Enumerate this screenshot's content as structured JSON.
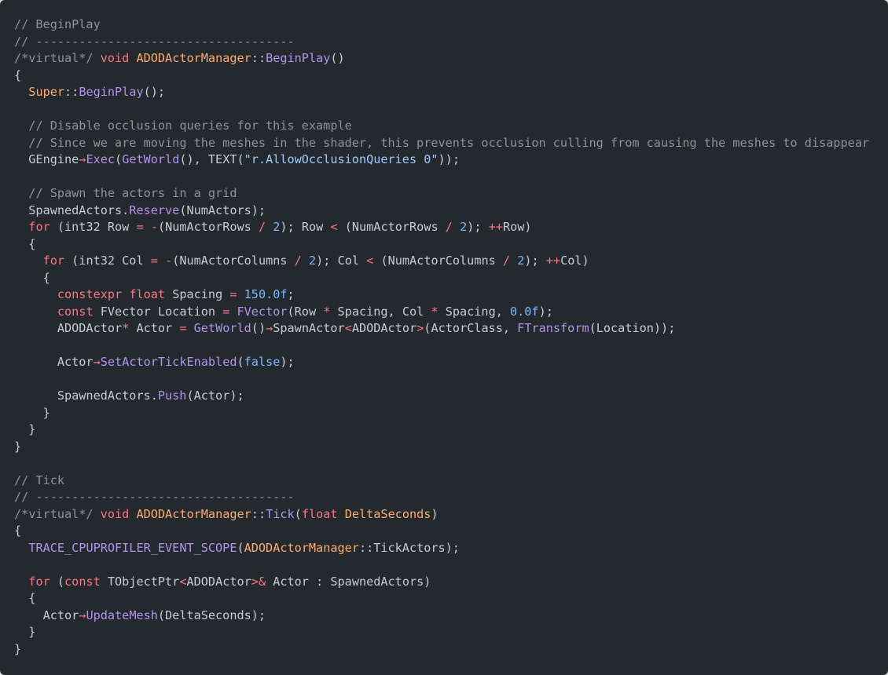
{
  "theme": {
    "background": "#24292e",
    "comment": "#8b949e",
    "keyword": "#f97583",
    "type": "#ffab70",
    "function": "#b392f0",
    "string": "#9ecbff",
    "number": "#79b8ff",
    "text": "#c6ccd4"
  },
  "code": {
    "lines": [
      [
        [
          "comment",
          "// BeginPlay"
        ]
      ],
      [
        [
          "comment",
          "// ------------------------------------"
        ]
      ],
      [
        [
          "comment",
          "/*virtual*/"
        ],
        [
          "plain",
          " "
        ],
        [
          "keyword",
          "void"
        ],
        [
          "plain",
          " "
        ],
        [
          "type",
          "ADODActorManager"
        ],
        [
          "plain",
          "::"
        ],
        [
          "func",
          "BeginPlay"
        ],
        [
          "plain",
          "()"
        ]
      ],
      [
        [
          "plain",
          "{"
        ]
      ],
      [
        [
          "plain",
          "  "
        ],
        [
          "type",
          "Super"
        ],
        [
          "plain",
          "::"
        ],
        [
          "func",
          "BeginPlay"
        ],
        [
          "plain",
          "();"
        ]
      ],
      [],
      [
        [
          "plain",
          "  "
        ],
        [
          "comment",
          "// Disable occlusion queries for this example"
        ]
      ],
      [
        [
          "plain",
          "  "
        ],
        [
          "comment",
          "// Since we are moving the meshes in the shader, this prevents occlusion culling from causing the meshes to disappear"
        ]
      ],
      [
        [
          "plain",
          "  GEngine"
        ],
        [
          "op",
          "→"
        ],
        [
          "func",
          "Exec"
        ],
        [
          "plain",
          "("
        ],
        [
          "func",
          "GetWorld"
        ],
        [
          "plain",
          "(), TEXT("
        ],
        [
          "string",
          "\"r.AllowOcclusionQueries 0\""
        ],
        [
          "plain",
          "));"
        ]
      ],
      [],
      [
        [
          "plain",
          "  "
        ],
        [
          "comment",
          "// Spawn the actors in a grid"
        ]
      ],
      [
        [
          "plain",
          "  SpawnedActors."
        ],
        [
          "func",
          "Reserve"
        ],
        [
          "plain",
          "(NumActors);"
        ]
      ],
      [
        [
          "plain",
          "  "
        ],
        [
          "keyword",
          "for"
        ],
        [
          "plain",
          " (int32 Row "
        ],
        [
          "op",
          "="
        ],
        [
          "plain",
          " "
        ],
        [
          "op",
          "-"
        ],
        [
          "plain",
          "(NumActorRows "
        ],
        [
          "op",
          "/"
        ],
        [
          "plain",
          " "
        ],
        [
          "number",
          "2"
        ],
        [
          "plain",
          "); Row "
        ],
        [
          "op",
          "<"
        ],
        [
          "plain",
          " (NumActorRows "
        ],
        [
          "op",
          "/"
        ],
        [
          "plain",
          " "
        ],
        [
          "number",
          "2"
        ],
        [
          "plain",
          "); "
        ],
        [
          "op",
          "++"
        ],
        [
          "plain",
          "Row)"
        ]
      ],
      [
        [
          "plain",
          "  {"
        ]
      ],
      [
        [
          "plain",
          "    "
        ],
        [
          "keyword",
          "for"
        ],
        [
          "plain",
          " (int32 Col "
        ],
        [
          "op",
          "="
        ],
        [
          "plain",
          " "
        ],
        [
          "op",
          "-"
        ],
        [
          "plain",
          "(NumActorColumns "
        ],
        [
          "op",
          "/"
        ],
        [
          "plain",
          " "
        ],
        [
          "number",
          "2"
        ],
        [
          "plain",
          "); Col "
        ],
        [
          "op",
          "<"
        ],
        [
          "plain",
          " (NumActorColumns "
        ],
        [
          "op",
          "/"
        ],
        [
          "plain",
          " "
        ],
        [
          "number",
          "2"
        ],
        [
          "plain",
          "); "
        ],
        [
          "op",
          "++"
        ],
        [
          "plain",
          "Col)"
        ]
      ],
      [
        [
          "plain",
          "    {"
        ]
      ],
      [
        [
          "plain",
          "      "
        ],
        [
          "keyword",
          "constexpr"
        ],
        [
          "plain",
          " "
        ],
        [
          "keyword",
          "float"
        ],
        [
          "plain",
          " Spacing "
        ],
        [
          "op",
          "="
        ],
        [
          "plain",
          " "
        ],
        [
          "number",
          "150.0f"
        ],
        [
          "plain",
          ";"
        ]
      ],
      [
        [
          "plain",
          "      "
        ],
        [
          "keyword",
          "const"
        ],
        [
          "plain",
          " FVector Location "
        ],
        [
          "op",
          "="
        ],
        [
          "plain",
          " "
        ],
        [
          "func",
          "FVector"
        ],
        [
          "plain",
          "(Row "
        ],
        [
          "op",
          "*"
        ],
        [
          "plain",
          " Spacing, Col "
        ],
        [
          "op",
          "*"
        ],
        [
          "plain",
          " Spacing, "
        ],
        [
          "number",
          "0.0f"
        ],
        [
          "plain",
          ");"
        ]
      ],
      [
        [
          "plain",
          "      ADODActor"
        ],
        [
          "op",
          "*"
        ],
        [
          "plain",
          " Actor "
        ],
        [
          "op",
          "="
        ],
        [
          "plain",
          " "
        ],
        [
          "func",
          "GetWorld"
        ],
        [
          "plain",
          "()"
        ],
        [
          "op",
          "→"
        ],
        [
          "plain",
          "SpawnActor"
        ],
        [
          "op",
          "<"
        ],
        [
          "plain",
          "ADODActor"
        ],
        [
          "op",
          ">"
        ],
        [
          "plain",
          "(ActorClass, "
        ],
        [
          "func",
          "FTransform"
        ],
        [
          "plain",
          "(Location));"
        ]
      ],
      [],
      [
        [
          "plain",
          "      Actor"
        ],
        [
          "op",
          "→"
        ],
        [
          "func",
          "SetActorTickEnabled"
        ],
        [
          "plain",
          "("
        ],
        [
          "literal",
          "false"
        ],
        [
          "plain",
          ");"
        ]
      ],
      [],
      [
        [
          "plain",
          "      SpawnedActors."
        ],
        [
          "func",
          "Push"
        ],
        [
          "plain",
          "(Actor);"
        ]
      ],
      [
        [
          "plain",
          "    }"
        ]
      ],
      [
        [
          "plain",
          "  }"
        ]
      ],
      [
        [
          "plain",
          "}"
        ]
      ],
      [],
      [
        [
          "comment",
          "// Tick"
        ]
      ],
      [
        [
          "comment",
          "// ------------------------------------"
        ]
      ],
      [
        [
          "comment",
          "/*virtual*/"
        ],
        [
          "plain",
          " "
        ],
        [
          "keyword",
          "void"
        ],
        [
          "plain",
          " "
        ],
        [
          "type",
          "ADODActorManager"
        ],
        [
          "plain",
          "::"
        ],
        [
          "func",
          "Tick"
        ],
        [
          "plain",
          "("
        ],
        [
          "keyword",
          "float"
        ],
        [
          "plain",
          " "
        ],
        [
          "type",
          "DeltaSeconds"
        ],
        [
          "plain",
          ")"
        ]
      ],
      [
        [
          "plain",
          "{"
        ]
      ],
      [
        [
          "plain",
          "  "
        ],
        [
          "func",
          "TRACE_CPUPROFILER_EVENT_SCOPE"
        ],
        [
          "plain",
          "("
        ],
        [
          "type",
          "ADODActorManager"
        ],
        [
          "plain",
          "::TickActors);"
        ]
      ],
      [],
      [
        [
          "plain",
          "  "
        ],
        [
          "keyword",
          "for"
        ],
        [
          "plain",
          " ("
        ],
        [
          "keyword",
          "const"
        ],
        [
          "plain",
          " TObjectPtr"
        ],
        [
          "op",
          "<"
        ],
        [
          "plain",
          "ADODActor"
        ],
        [
          "op",
          ">&"
        ],
        [
          "plain",
          " Actor : SpawnedActors)"
        ]
      ],
      [
        [
          "plain",
          "  {"
        ]
      ],
      [
        [
          "plain",
          "    Actor"
        ],
        [
          "op",
          "→"
        ],
        [
          "func",
          "UpdateMesh"
        ],
        [
          "plain",
          "(DeltaSeconds);"
        ]
      ],
      [
        [
          "plain",
          "  }"
        ]
      ],
      [
        [
          "plain",
          "}"
        ]
      ]
    ]
  }
}
